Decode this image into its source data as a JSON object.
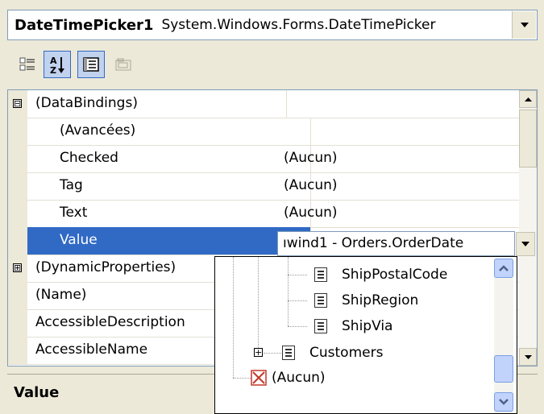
{
  "selector": {
    "object_name": "DateTimePicker1",
    "object_type": "System.Windows.Forms.DateTimePicker"
  },
  "toolbar": {
    "categorized_icon": "categorized-icon",
    "alphabetical_icon": "alphabetical-sort-icon",
    "properties_icon": "properties-icon",
    "events_icon": "property-pages-icon"
  },
  "grid": {
    "rows": [
      {
        "name": "(DataBindings)",
        "value": "",
        "expander": "⊟"
      },
      {
        "name": "(Avancées)",
        "value": ""
      },
      {
        "name": "Checked",
        "value": "(Aucun)"
      },
      {
        "name": "Tag",
        "value": "(Aucun)"
      },
      {
        "name": "Text",
        "value": "(Aucun)"
      },
      {
        "name": "Value",
        "value": "ıwind1 - Orders.OrderDate"
      },
      {
        "name": "(DynamicProperties)",
        "value": "",
        "expander": "⊞"
      },
      {
        "name": "(Name)",
        "value": ""
      },
      {
        "name": "AccessibleDescription",
        "value": ""
      },
      {
        "name": "AccessibleName",
        "value": ""
      }
    ]
  },
  "popup": {
    "items": [
      "ShipPostalCode",
      "ShipRegion",
      "ShipVia",
      "Customers",
      "(Aucun)"
    ]
  },
  "description": {
    "title": "Value"
  },
  "colors": {
    "selection": "#316ac5",
    "chrome": "#ece9d8"
  }
}
